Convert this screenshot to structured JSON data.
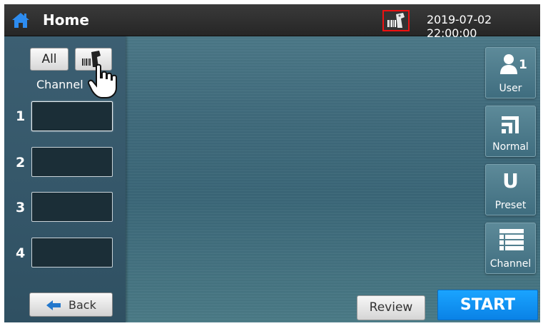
{
  "header": {
    "title": "Home",
    "datetime": "2019-07-02 22:00:00",
    "home_icon": "home-icon",
    "scanner_icon": "barcode-scanner-icon",
    "scanner_highlight_color": "#e11111"
  },
  "left_panel": {
    "all_button": "All",
    "scan_button_icon": "barcode-scanner-icon",
    "channel_label": "Channel",
    "channels": [
      {
        "number": "1",
        "value": ""
      },
      {
        "number": "2",
        "value": ""
      },
      {
        "number": "3",
        "value": ""
      },
      {
        "number": "4",
        "value": ""
      }
    ],
    "back_button": "Back"
  },
  "side_buttons": {
    "user": {
      "label": "User",
      "count": "1",
      "icon": "user-icon"
    },
    "normal": {
      "label": "Normal",
      "icon": "normal-mode-icon"
    },
    "preset": {
      "label": "Preset",
      "glyph": "U",
      "icon": "preset-icon"
    },
    "channel": {
      "label": "Channel",
      "icon": "channel-list-icon"
    }
  },
  "footer": {
    "review_button": "Review",
    "start_button": "START",
    "start_color": "#1a9bff"
  }
}
